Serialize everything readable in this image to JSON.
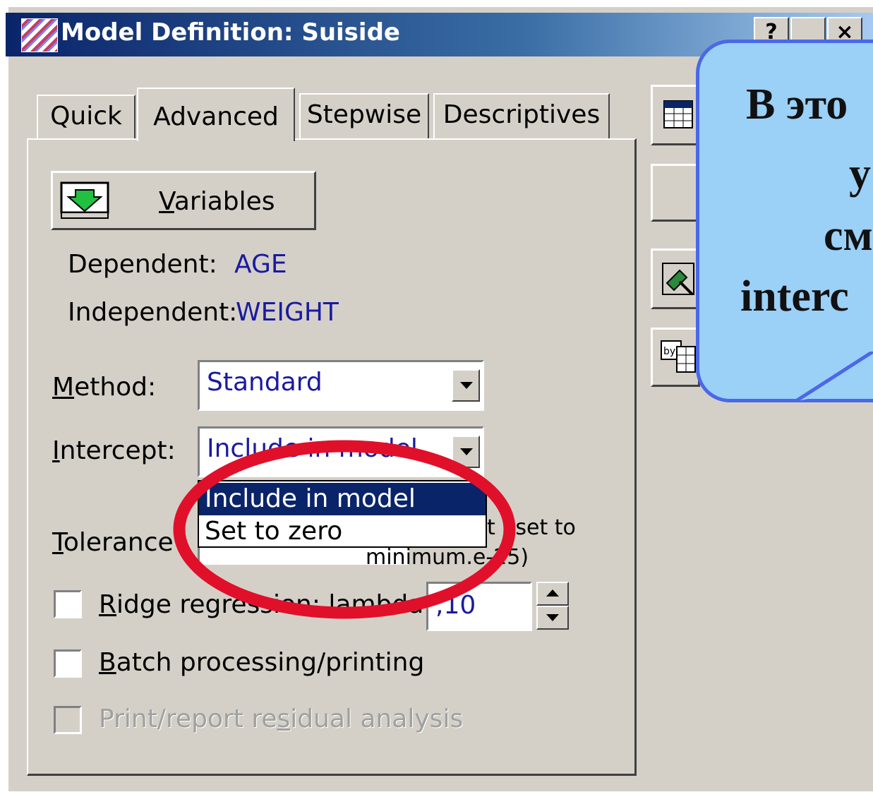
{
  "window": {
    "title": "Model Definition: Suiside",
    "help_label": "?",
    "close_label": "×"
  },
  "tabs": [
    {
      "label": "Quick"
    },
    {
      "label": "Advanced"
    },
    {
      "label": "Stepwise"
    },
    {
      "label": "Descriptives"
    }
  ],
  "variables_button": {
    "label_u": "V",
    "label_rest": "ariables"
  },
  "dependent": {
    "label": "Dependent:",
    "value": "AGE"
  },
  "independent": {
    "label": "Independent:",
    "value": "WEIGHT"
  },
  "method": {
    "label_u": "M",
    "label_rest": "ethod:",
    "value": "Standard"
  },
  "intercept": {
    "label_u": "I",
    "label_rest": "ntercept:",
    "value": "Include in model",
    "options": [
      "Include in model",
      "Set to zero"
    ]
  },
  "tolerance": {
    "label_u": "T",
    "label_rest": "olerance",
    "note_a": "t",
    "note_b": "set to",
    "note_c": "minimum",
    "note_d": ".e-25)"
  },
  "ridge": {
    "label_u": "R",
    "label_rest": "idge regression; lambda:",
    "value": ",10"
  },
  "batch": {
    "label_u": "B",
    "label_rest": "atch processing/printing"
  },
  "residual": {
    "label_a": "Print/report re",
    "label_u": "s",
    "label_b": "idual analysis"
  },
  "callout": {
    "lines": [
      "В это",
      "у",
      "см",
      "interc"
    ]
  }
}
